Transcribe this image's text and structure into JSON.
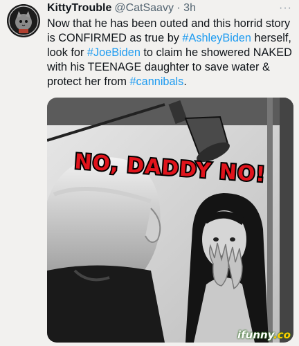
{
  "tweet": {
    "author_name": "KittyTrouble",
    "handle": "@CatSaavy",
    "separator": " · ",
    "time": "3h",
    "more_icon": "more-icon",
    "text": {
      "part1": "Now that he has been outed and this horrid story is CONFIRMED as true by ",
      "tag1": "#AshleyBiden",
      "part2": " herself, look for ",
      "tag2": "#JoeBiden",
      "part3": " to claim he showered NAKED with his TEENAGE daughter to save water & protect her from ",
      "tag3": "#cannibals",
      "part4": "."
    },
    "hashtag_color": "#1d9bf0"
  },
  "meme": {
    "caption": "NO, DADDY NO!",
    "caption_color": "#e0141c"
  },
  "watermark": {
    "main": "ifunny",
    "suffix": ".co"
  }
}
